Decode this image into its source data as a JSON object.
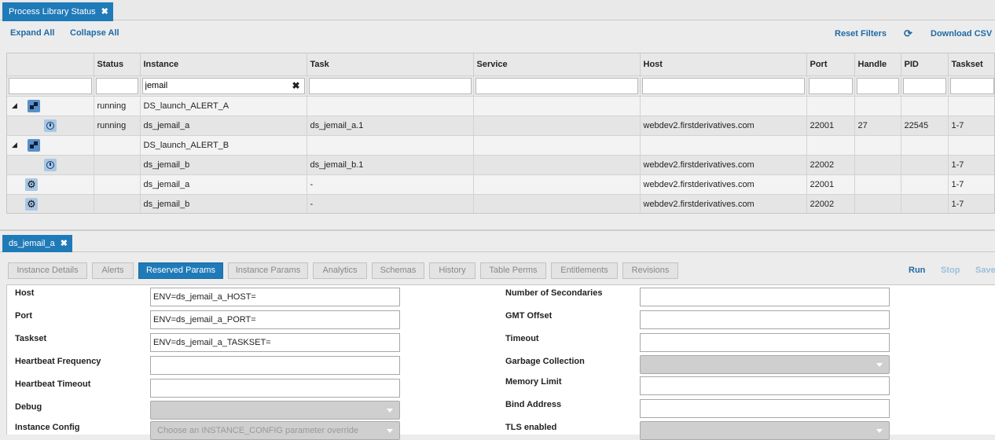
{
  "app": {
    "main_tab": "Process Library Status",
    "tab_close": "✖"
  },
  "toolbar": {
    "expand_all": "Expand All",
    "collapse_all": "Collapse All",
    "reset_filters": "Reset Filters",
    "refresh_icon": "⟳",
    "download_csv": "Download CSV"
  },
  "grid": {
    "columns": [
      "Status",
      "Instance",
      "Task",
      "Service",
      "Host",
      "Port",
      "Handle",
      "PID",
      "Taskset"
    ],
    "filter_instance_value": "jemail",
    "clear_filter": "✖",
    "rows": [
      {
        "status": "running",
        "instance": "DS_launch_ALERT_A",
        "task": "",
        "service": "",
        "host": "",
        "port": "",
        "handle": "",
        "pid": "",
        "taskset": ""
      },
      {
        "status": "running",
        "instance": "ds_jemail_a",
        "task": "ds_jemail_a.1",
        "service": "",
        "host": "webdev2.firstderivatives.com",
        "port": "22001",
        "handle": "27",
        "pid": "22545",
        "taskset": "1-7"
      },
      {
        "status": "",
        "instance": "DS_launch_ALERT_B",
        "task": "",
        "service": "",
        "host": "",
        "port": "",
        "handle": "",
        "pid": "",
        "taskset": ""
      },
      {
        "status": "",
        "instance": "ds_jemail_b",
        "task": "ds_jemail_b.1",
        "service": "",
        "host": "webdev2.firstderivatives.com",
        "port": "22002",
        "handle": "",
        "pid": "",
        "taskset": "1-7"
      },
      {
        "status": "",
        "instance": "ds_jemail_a",
        "task": "-",
        "service": "",
        "host": "webdev2.firstderivatives.com",
        "port": "22001",
        "handle": "",
        "pid": "",
        "taskset": "1-7"
      },
      {
        "status": "",
        "instance": "ds_jemail_b",
        "task": "-",
        "service": "",
        "host": "webdev2.firstderivatives.com",
        "port": "22002",
        "handle": "",
        "pid": "",
        "taskset": "1-7"
      }
    ]
  },
  "detail": {
    "tab": "ds_jemail_a",
    "subtabs": [
      "Instance Details",
      "Alerts",
      "Reserved Params",
      "Instance Params",
      "Analytics",
      "Schemas",
      "History",
      "Table Perms",
      "Entitlements",
      "Revisions"
    ],
    "active_subtab": "Reserved Params",
    "actions": {
      "run": "Run",
      "stop": "Stop",
      "save": "Save"
    },
    "left_fields": [
      {
        "label": "Host",
        "value": "ENV=ds_jemail_a_HOST="
      },
      {
        "label": "Port",
        "value": "ENV=ds_jemail_a_PORT="
      },
      {
        "label": "Taskset",
        "value": "ENV=ds_jemail_a_TASKSET="
      },
      {
        "label": "Heartbeat Frequency",
        "value": ""
      },
      {
        "label": "Heartbeat Timeout",
        "value": ""
      },
      {
        "label": "Debug",
        "value": ""
      },
      {
        "label": "Instance Config",
        "placeholder": "Choose an INSTANCE_CONFIG parameter override"
      }
    ],
    "right_fields": [
      {
        "label": "Number of Secondaries",
        "value": ""
      },
      {
        "label": "GMT Offset",
        "value": ""
      },
      {
        "label": "Timeout",
        "value": ""
      },
      {
        "label": "Garbage Collection",
        "value": ""
      },
      {
        "label": "Memory Limit",
        "value": ""
      },
      {
        "label": "Bind Address",
        "value": ""
      },
      {
        "label": "TLS enabled",
        "value": ""
      }
    ]
  },
  "colors": {
    "accent": "#1f7ab8",
    "link": "#1f6aa5"
  }
}
